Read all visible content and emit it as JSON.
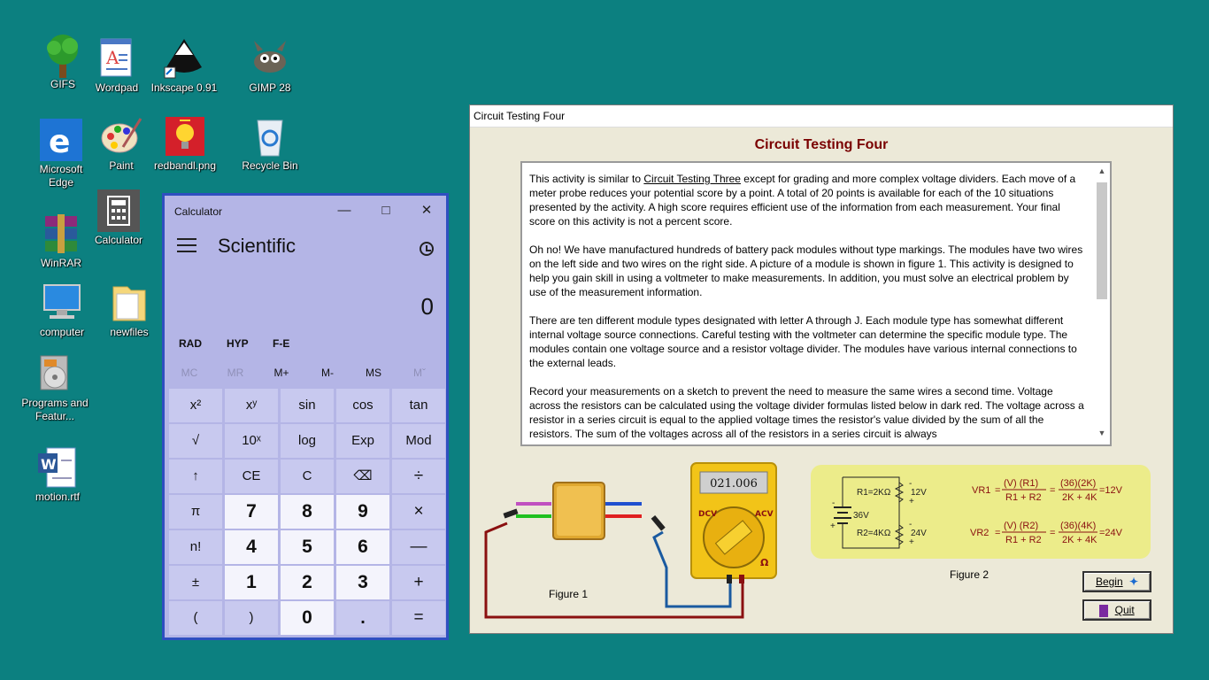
{
  "desktop": {
    "icons": [
      {
        "label": "GIFS"
      },
      {
        "label": "Wordpad"
      },
      {
        "label": "Inkscape 0.91"
      },
      {
        "label": "GIMP 28"
      },
      {
        "label": "Microsoft Edge"
      },
      {
        "label": "Paint"
      },
      {
        "label": "redbandl.png"
      },
      {
        "label": "Recycle Bin"
      },
      {
        "label": "WinRAR"
      },
      {
        "label": "Calculator"
      },
      {
        "label": "computer"
      },
      {
        "label": "newfiles"
      },
      {
        "label": "Programs and Featur..."
      },
      {
        "label": "motion.rtf"
      }
    ]
  },
  "calculator": {
    "title": "Calculator",
    "mode": "Scientific",
    "display": "0",
    "angle": [
      "RAD",
      "HYP",
      "F-E"
    ],
    "memory": [
      "MC",
      "MR",
      "M+",
      "M-",
      "MS",
      "Mˇ"
    ],
    "keys": [
      [
        "x²",
        "xʸ",
        "sin",
        "cos",
        "tan"
      ],
      [
        "√",
        "10ˣ",
        "log",
        "Exp",
        "Mod"
      ],
      [
        "↑",
        "CE",
        "C",
        "⌫",
        "÷"
      ],
      [
        "π",
        "7",
        "8",
        "9",
        "×"
      ],
      [
        "n!",
        "4",
        "5",
        "6",
        "—"
      ],
      [
        "±",
        "1",
        "2",
        "3",
        "+"
      ],
      [
        "(",
        ")",
        "0",
        ".",
        "="
      ]
    ]
  },
  "circuit_window": {
    "title": "Circuit Testing Four",
    "heading": "Circuit Testing Four",
    "p1_before": "This activity is similar to ",
    "p1_link": "Circuit Testing Three",
    "p1_after": " except for grading and more complex voltage dividers. Each move of a meter probe reduces your potential score by a point. A total of 20 points is available for each of the 10 situations presented by the activity. A high score requires efficient use of the information from each measurement. Your final score on this activity is not a percent score.",
    "p2": "Oh no! We have manufactured hundreds of battery pack modules without type markings. The modules have two wires on the left side and two wires on the right side. A picture of a module is shown in figure 1. This activity is designed to help you gain skill in using a voltmeter to make measurements. In addition, you must solve an electrical problem by use of the measurement information.",
    "p3": "There are ten different module types designated with letter A through J. Each module type has somewhat different internal voltage source connections. Careful testing with the voltmeter can determine the specific module type. The modules contain one voltage source and a resistor voltage divider. The modules have various internal connections to the external leads.",
    "p4": "Record your measurements on a sketch to prevent the need to measure the same wires a second time. Voltage across the resistors can be calculated using the voltage divider formulas listed below in dark red. The voltage across a resistor in a series circuit is equal to the applied voltage times the resistor's value divided by the sum of all the resistors. The sum of the voltages across all of the resistors in a series circuit is always",
    "meter_reading": "021.006",
    "meter_dcv": "DCV",
    "meter_acv": "ACV",
    "meter_ohm": "Ω",
    "figure1": "Figure 1",
    "figure2": "Figure 2",
    "fig2": {
      "r1": "R1=2KΩ",
      "r2": "R2=4KΩ",
      "v_src": "36V",
      "v1": "12V",
      "v2": "24V",
      "vr1": "VR1",
      "vr2": "VR2",
      "eq_v": "(V) (R1)",
      "eq_v2": "(V) (R2)",
      "eq_den": "R1 + R2",
      "eq_num1": "(36)(2K)",
      "eq_num2": "(36)(4K)",
      "eq_den2": "2K + 4K",
      "res1": "=12V",
      "res2": "=24V"
    },
    "begin": "Begin",
    "quit": "Quit"
  }
}
